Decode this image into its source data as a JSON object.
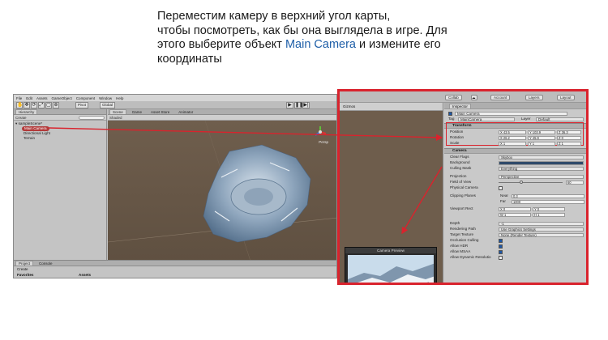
{
  "caption": {
    "line1": "Переместим камеру в верхний угол карты,",
    "line2": "чтобы посмотреть, как бы она выглядела в игре. Для",
    "line3_pre": "этого выберите объект ",
    "line3_highlight": "Main Camera",
    "line3_post": " и измените его",
    "line4": "координаты"
  },
  "editor": {
    "menu": [
      "File",
      "Edit",
      "Assets",
      "GameObject",
      "Component",
      "Window",
      "Help"
    ],
    "pivot_label": "Pivot",
    "global_label": "Global",
    "hierarchy": {
      "tab": "Hierarchy",
      "create_label": "Create",
      "scene_name": "sampleScene*",
      "items": [
        "Main Camera",
        "Directional Light",
        "Terrain"
      ]
    },
    "scene": {
      "tabs": [
        "Scene",
        "Game",
        "Asset Store",
        "Animator"
      ],
      "shaded_label": "Shaded",
      "gizmo_label": "Persp"
    },
    "bottom": {
      "tabs": [
        "Project",
        "Console"
      ],
      "create_label": "Create",
      "favorites_label": "Favorites",
      "assets_label": "Assets"
    }
  },
  "inspector_window": {
    "toolbar": {
      "collab": "Collab",
      "account": "Account",
      "layers": "Layers",
      "layout": "Layout",
      "gizmos": "Gizmos"
    },
    "tab": "Inspector",
    "object_name": "Main Camera",
    "tag_label": "Tag",
    "tag_value": "MainCamera",
    "layer_label": "Layer",
    "layer_value": "Default",
    "transform": {
      "title": "Transform",
      "position_label": "Position",
      "position": {
        "x": "X 43.5",
        "y": "Y 103.9",
        "z": "Z 36.3"
      },
      "rotation_label": "Rotation",
      "rotation": {
        "x": "X 26.2",
        "y": "Y 45.9",
        "z": "Z 0"
      },
      "scale_label": "Scale",
      "scale": {
        "x": "X 1",
        "y": "Y 1",
        "z": "Z 1"
      }
    },
    "camera": {
      "title": "Camera",
      "clear_flags_label": "Clear Flags",
      "clear_flags": "Skybox",
      "background_label": "Background",
      "culling_mask_label": "Culling Mask",
      "culling_mask": "Everything",
      "projection_label": "Projection",
      "projection": "Perspective",
      "fov_label": "Field of View",
      "fov": "60",
      "physical_label": "Physical Camera",
      "clipping_label": "Clipping Planes",
      "near_label": "Near",
      "near": "0.3",
      "far_label": "Far",
      "far": "1000",
      "viewport_label": "Viewport Rect",
      "vx": "X 0",
      "vy": "Y 0",
      "vw": "W 1",
      "vh": "H 1",
      "depth_label": "Depth",
      "depth": "-1",
      "rendering_label": "Rendering Path",
      "rendering": "Use Graphics Settings",
      "target_label": "Target Texture",
      "target": "None (Render Texture)",
      "occlusion_label": "Occlusion Culling",
      "hdr_label": "Allow HDR",
      "msaa_label": "Allow MSAA",
      "dynres_label": "Allow Dynamic Resolutio"
    },
    "preview_title": "Camera Preview"
  },
  "colors": {
    "highlight": "#d9232d",
    "link": "#1f5fa8"
  }
}
